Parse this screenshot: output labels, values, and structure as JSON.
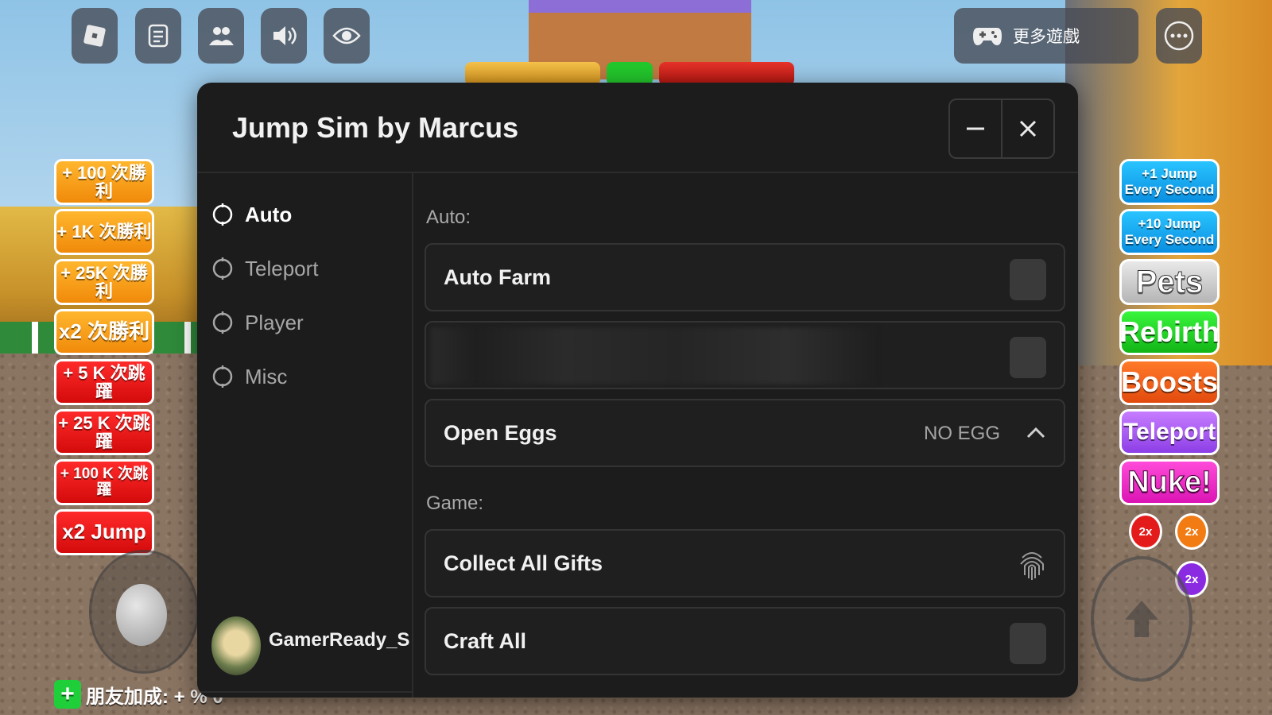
{
  "top_bar": {
    "more_games_label": "更多遊戲"
  },
  "left_boosts": [
    {
      "label": "+ 100 次勝利"
    },
    {
      "label": "+ 1K 次勝利"
    },
    {
      "label": "+ 25K 次勝利"
    },
    {
      "label": "x2 次勝利"
    },
    {
      "label": "+ 5 K 次跳躍"
    },
    {
      "label": "+ 25 K 次跳躍"
    },
    {
      "label": "+ 100 K 次跳躍"
    },
    {
      "label": "x2 Jump"
    }
  ],
  "right_buttons": [
    {
      "label": "+1 Jump Every Second"
    },
    {
      "label": "+10 Jump Every Second"
    },
    {
      "label": "Pets"
    },
    {
      "label": "Rebirth"
    },
    {
      "label": "Boosts"
    },
    {
      "label": "Teleport"
    },
    {
      "label": "Nuke!"
    }
  ],
  "badges": [
    "2x",
    "2x",
    "2x"
  ],
  "friend_boost": {
    "label": "朋友加成: + % 0"
  },
  "panel": {
    "title": "Jump Sim by Marcus",
    "sidebar": {
      "items": [
        {
          "label": "Auto",
          "active": true
        },
        {
          "label": "Teleport",
          "active": false
        },
        {
          "label": "Player",
          "active": false
        },
        {
          "label": "Misc",
          "active": false
        }
      ]
    },
    "user": {
      "name": "GamerReady_S"
    },
    "sections": {
      "auto_label": "Auto:",
      "game_label": "Game:"
    },
    "rows": {
      "auto_farm": {
        "label": "Auto Farm"
      },
      "open_eggs": {
        "label": "Open Eggs",
        "value": "NO EGG"
      },
      "collect_gifts": {
        "label": "Collect All Gifts"
      },
      "craft_all": {
        "label": "Craft All"
      }
    }
  },
  "colors": {
    "panel_bg": "#1c1c1c",
    "row_border": "#343434",
    "toggle_off": "#3a3a3a"
  }
}
